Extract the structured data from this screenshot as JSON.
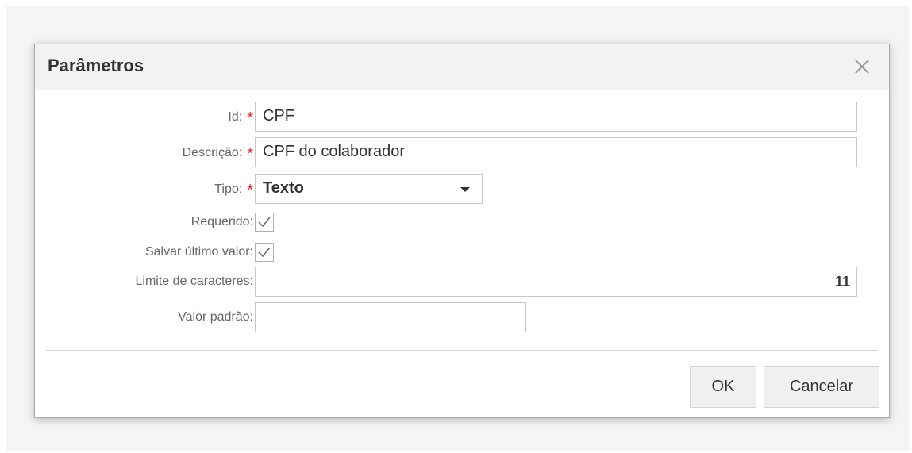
{
  "dialog": {
    "title": "Parâmetros",
    "close_icon": "close-icon"
  },
  "form": {
    "id": {
      "label": "Id:",
      "required_mark": "*",
      "value": "CPF"
    },
    "descricao": {
      "label": "Descrição:",
      "required_mark": "*",
      "value": "CPF do colaborador"
    },
    "tipo": {
      "label": "Tipo:",
      "required_mark": "*",
      "value": "Texto"
    },
    "requerido": {
      "label": "Requerido:",
      "checked": true
    },
    "salvar_ultimo": {
      "label": "Salvar último valor:",
      "checked": true
    },
    "limite": {
      "label": "Limite de caracteres:",
      "value": "11"
    },
    "valor_padrao": {
      "label": "Valor padrão:",
      "value": ""
    }
  },
  "buttons": {
    "ok": "OK",
    "cancel": "Cancelar"
  },
  "colors": {
    "required": "#d9302c",
    "header_bg": "#f2f2f2"
  }
}
